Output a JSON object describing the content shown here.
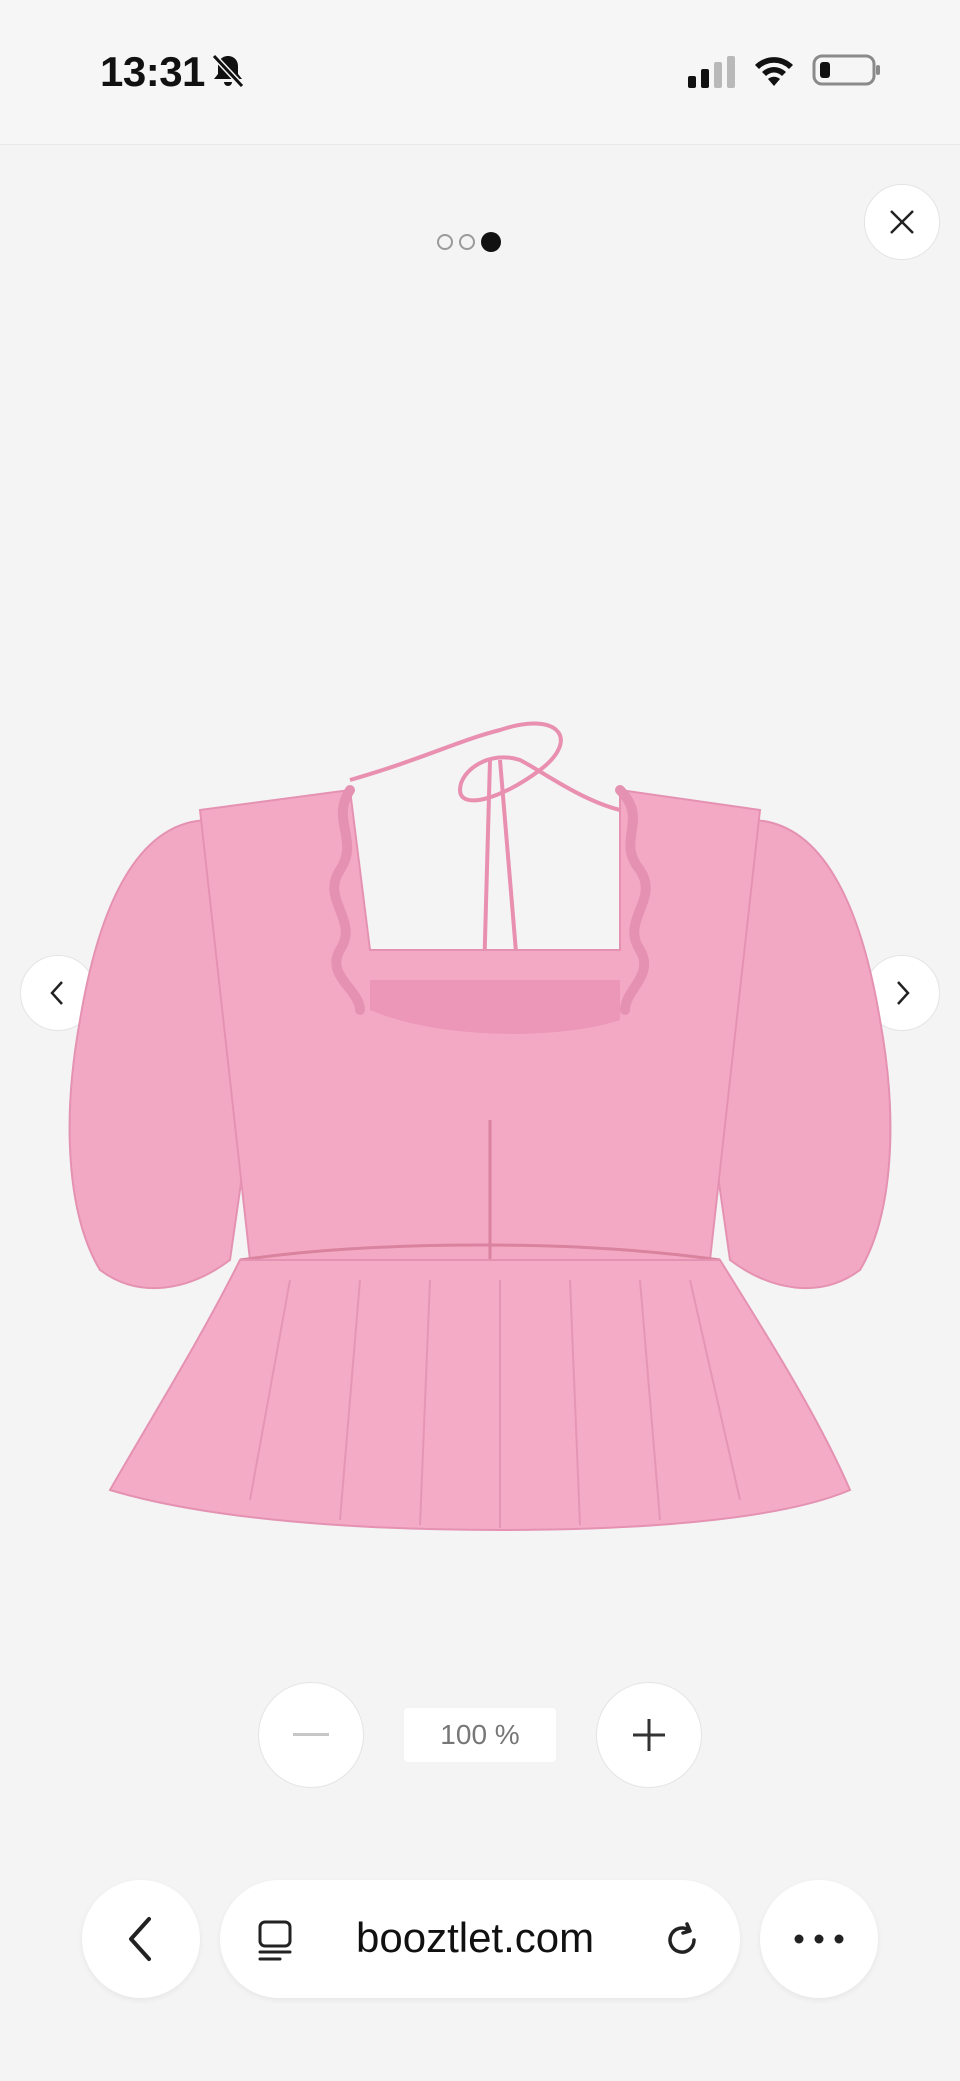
{
  "status_bar": {
    "time": "13:31",
    "icons": [
      "bell-slash-icon",
      "cellular-signal-icon",
      "wifi-icon",
      "battery-icon"
    ]
  },
  "gallery": {
    "total_images": 3,
    "current_index": 3,
    "close_icon": "close-icon",
    "prev_icon": "chevron-left-icon",
    "next_icon": "chevron-right-icon",
    "product_color": "#f2a8c2"
  },
  "zoom": {
    "level": "100 %",
    "zoom_out_icon": "minus-icon",
    "zoom_in_icon": "plus-icon"
  },
  "browser": {
    "url": "booztlet.com",
    "back_icon": "chevron-left-icon",
    "tabs_icon": "tabs-icon",
    "reload_icon": "reload-icon",
    "more_icon": "more-icon"
  }
}
